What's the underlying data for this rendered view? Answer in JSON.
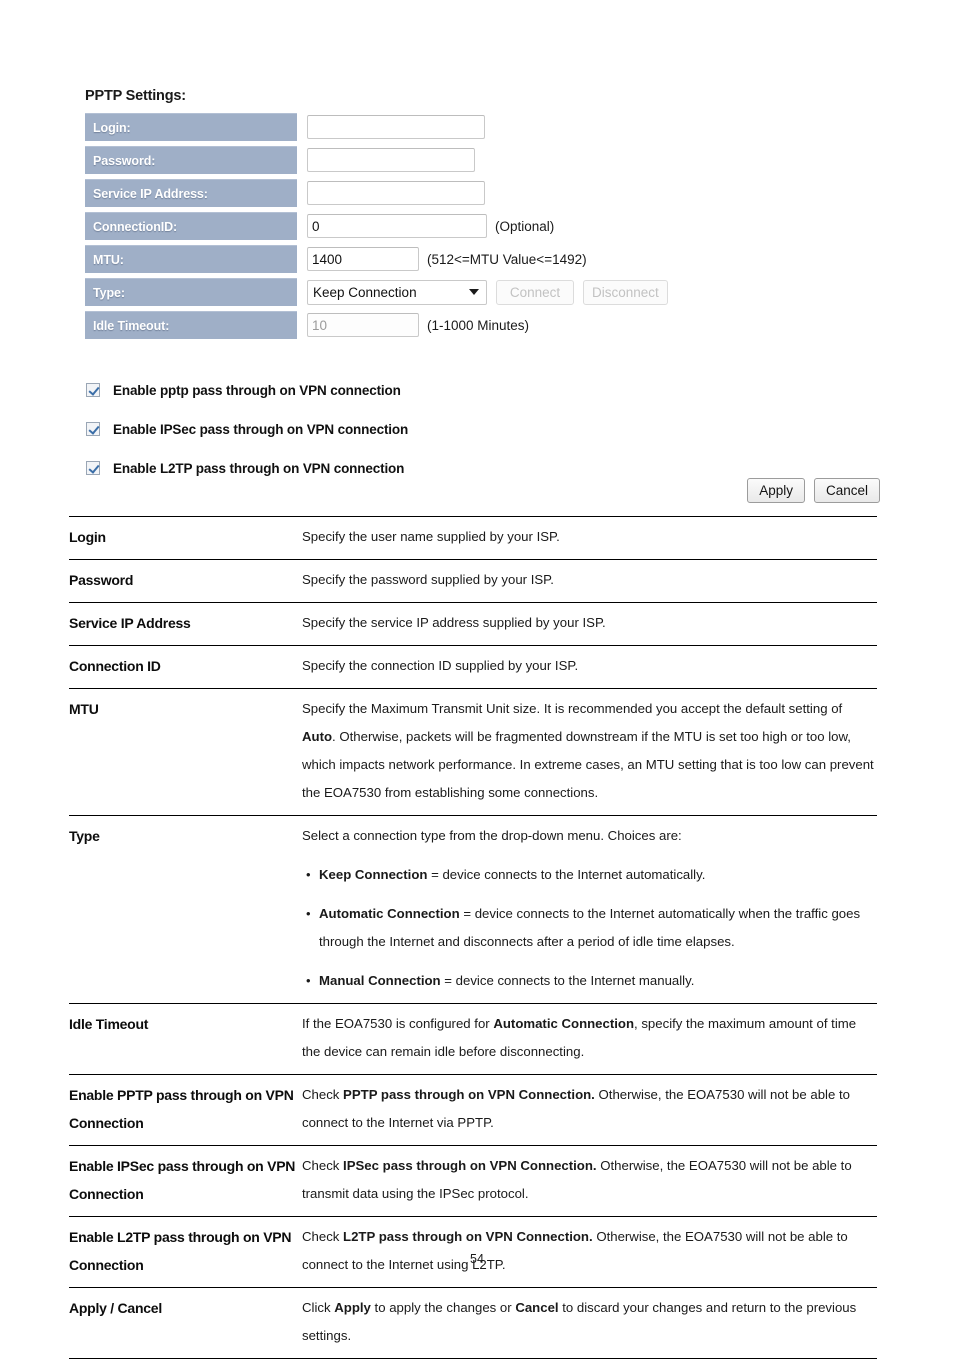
{
  "panel": {
    "title": "PPTP Settings:",
    "fields": [
      {
        "label": "Login:",
        "value": "",
        "hint": ""
      },
      {
        "label": "Password:",
        "value": "",
        "hint": ""
      },
      {
        "label": "Service IP Address:",
        "value": "",
        "hint": ""
      },
      {
        "label": "ConnectionID:",
        "value": "0",
        "hint": "(Optional)"
      },
      {
        "label": "MTU:",
        "value": "1400",
        "hint": "(512<=MTU Value<=1492)"
      },
      {
        "label": "Type:",
        "value": "Keep Connection",
        "hint": ""
      },
      {
        "label": "Idle Timeout:",
        "value": "10",
        "hint": "(1-1000 Minutes)"
      }
    ],
    "type_selected": "Keep Connection",
    "connect_label": "Connect",
    "disconnect_label": "Disconnect",
    "idle_timeout_value": "10"
  },
  "checkboxes": [
    {
      "label": "Enable pptp pass through on VPN connection",
      "checked": true
    },
    {
      "label": "Enable IPSec pass through on VPN connection",
      "checked": true
    },
    {
      "label": "Enable L2TP pass through on VPN connection",
      "checked": true
    }
  ],
  "actions": {
    "apply_label": "Apply",
    "cancel_label": "Cancel"
  },
  "reference_table": {
    "rows": [
      {
        "term": "Login",
        "desc": "Specify the user name supplied by your ISP."
      },
      {
        "term": "Password",
        "desc": "Specify the password supplied by your ISP."
      },
      {
        "term": "Service IP Address",
        "desc": "Specify the service IP address supplied by your ISP."
      },
      {
        "term": "Connection ID",
        "desc": "Specify the connection ID supplied by your ISP."
      },
      {
        "term": "MTU",
        "desc_html": "Specify the Maximum Transmit Unit size. It is recommended you accept the default setting of <b>Auto</b>. Otherwise, packets will be fragmented downstream if the MTU is set too high or too low, which impacts network performance. In extreme cases, an MTU setting that is too low can prevent the EOA7530 from establishing some connections."
      },
      {
        "term": "Type",
        "desc_intro": "Select a connection type from the drop-down menu. Choices are:",
        "bullets": [
          "<b>Keep Connection</b> = device connects to the Internet automatically.",
          "<b>Automatic Connection</b> = device connects to the Internet automatically when the traffic goes through the Internet and disconnects after a period of idle time elapses.",
          "<b>Manual Connection</b> = device connects to the Internet manually."
        ]
      },
      {
        "term": "Idle Timeout",
        "desc_html": "If the EOA7530 is configured for <b>Automatic Connection</b>, specify the maximum amount of time the device can remain idle before disconnecting."
      },
      {
        "term": "Enable PPTP pass through on VPN Connection",
        "desc_html": "Check <b>PPTP pass through on VPN Connection.</b> Otherwise, the EOA7530 will not be able to connect to the Internet via PPTP."
      },
      {
        "term": "Enable IPSec pass through on VPN Connection",
        "desc_html": "Check <b>IPSec pass through on VPN Connection.</b> Otherwise, the EOA7530 will not be able to transmit data using the IPSec protocol."
      },
      {
        "term": "Enable L2TP pass through on VPN Connection",
        "desc_html": "Check <b>L2TP pass through on VPN Connection.</b> Otherwise, the EOA7530 will not be able to connect to the Internet using L2TP."
      },
      {
        "term": "Apply / Cancel",
        "desc_html": "Click <b>Apply</b> to apply the changes or <b>Cancel</b> to discard your changes and return to the previous settings."
      }
    ]
  },
  "footer": {
    "page_number": "54"
  },
  "colors": {
    "label_background": "#9fafc7",
    "label_text": "#ffffff",
    "checkbox_check": "#3b6ea8",
    "table_rule": "#000000"
  }
}
